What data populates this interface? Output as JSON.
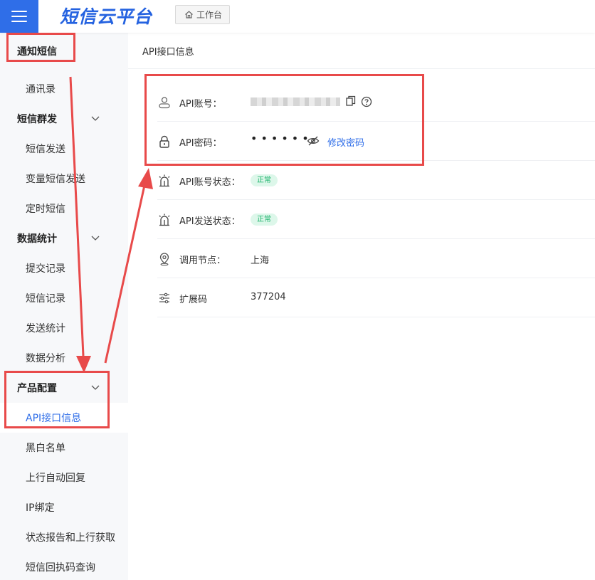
{
  "header": {
    "brand": "短信云平台",
    "workbench_label": "工作台"
  },
  "sidebar": {
    "section_title": "通知短信",
    "items": [
      {
        "label": "通讯录",
        "type": "sub"
      },
      {
        "label": "短信群发",
        "type": "group"
      },
      {
        "label": "短信发送",
        "type": "sub"
      },
      {
        "label": "变量短信发送",
        "type": "sub"
      },
      {
        "label": "定时短信",
        "type": "sub"
      },
      {
        "label": "数据统计",
        "type": "group"
      },
      {
        "label": "提交记录",
        "type": "sub"
      },
      {
        "label": "短信记录",
        "type": "sub"
      },
      {
        "label": "发送统计",
        "type": "sub"
      },
      {
        "label": "数据分析",
        "type": "sub"
      },
      {
        "label": "产品配置",
        "type": "group"
      },
      {
        "label": "API接口信息",
        "type": "sub",
        "active": true
      },
      {
        "label": "黑白名单",
        "type": "sub"
      },
      {
        "label": "上行自动回复",
        "type": "sub"
      },
      {
        "label": "IP绑定",
        "type": "sub"
      },
      {
        "label": "状态报告和上行获取",
        "type": "sub"
      },
      {
        "label": "短信回执码查询",
        "type": "sub"
      }
    ]
  },
  "main": {
    "title": "API接口信息",
    "rows": {
      "account": {
        "label": "API账号：",
        "icon": "user-icon"
      },
      "password": {
        "label": "API密码：",
        "value": "••••••",
        "link": "修改密码",
        "icon": "lock-icon"
      },
      "account_status": {
        "label": "API账号状态：",
        "badge": "正常",
        "icon": "alarm-icon"
      },
      "send_status": {
        "label": "API发送状态：",
        "badge": "正常",
        "icon": "alarm-icon"
      },
      "node": {
        "label": "调用节点：",
        "value": "上海",
        "icon": "location-icon"
      },
      "ext_code": {
        "label": "扩展码",
        "value": "377204",
        "icon": "sliders-icon"
      }
    }
  },
  "colors": {
    "accent": "#2f6ee8",
    "annotation": "#e84a4a",
    "status_green": "#19b269"
  }
}
